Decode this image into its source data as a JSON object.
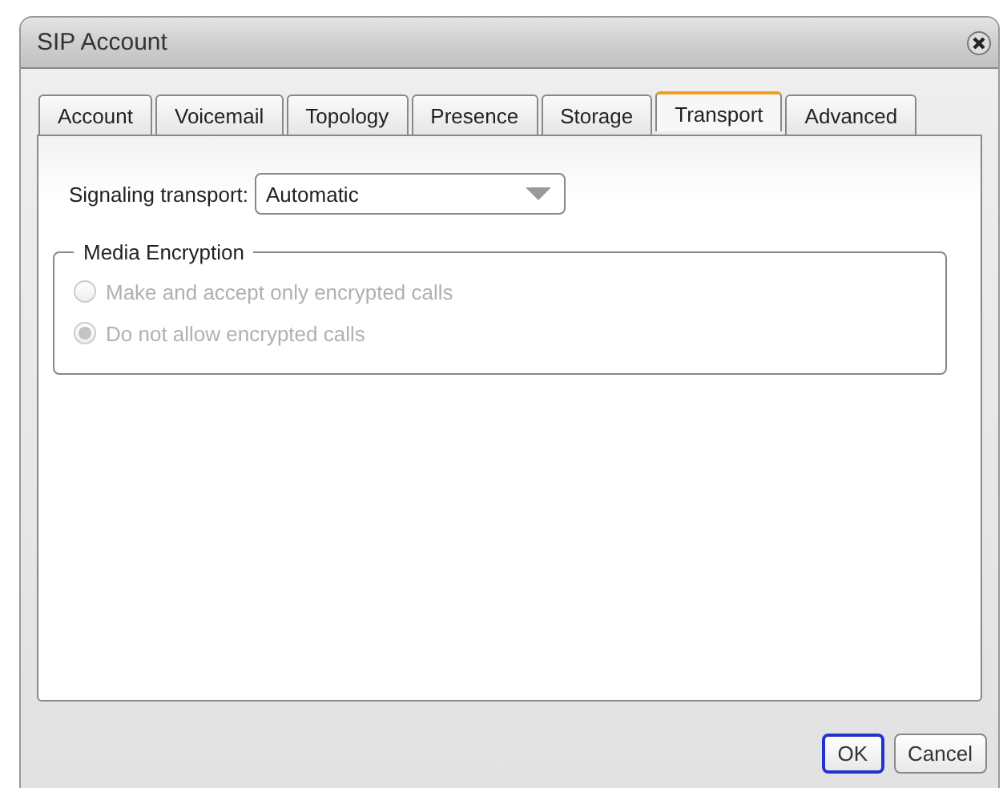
{
  "window": {
    "title": "SIP Account"
  },
  "tabs": [
    {
      "label": "Account",
      "selected": false
    },
    {
      "label": "Voicemail",
      "selected": false
    },
    {
      "label": "Topology",
      "selected": false
    },
    {
      "label": "Presence",
      "selected": false
    },
    {
      "label": "Storage",
      "selected": false
    },
    {
      "label": "Transport",
      "selected": true
    },
    {
      "label": "Advanced",
      "selected": false
    }
  ],
  "signaling_transport": {
    "label": "Signaling transport:",
    "value": "Automatic"
  },
  "media_encryption": {
    "title": "Media Encryption",
    "options": [
      {
        "label": "Make and accept only encrypted calls",
        "selected": false,
        "disabled": true
      },
      {
        "label": "Do not allow encrypted calls",
        "selected": true,
        "disabled": true
      }
    ]
  },
  "buttons": [
    {
      "label": "OK",
      "default": true
    },
    {
      "label": "Cancel",
      "default": false
    }
  ]
}
